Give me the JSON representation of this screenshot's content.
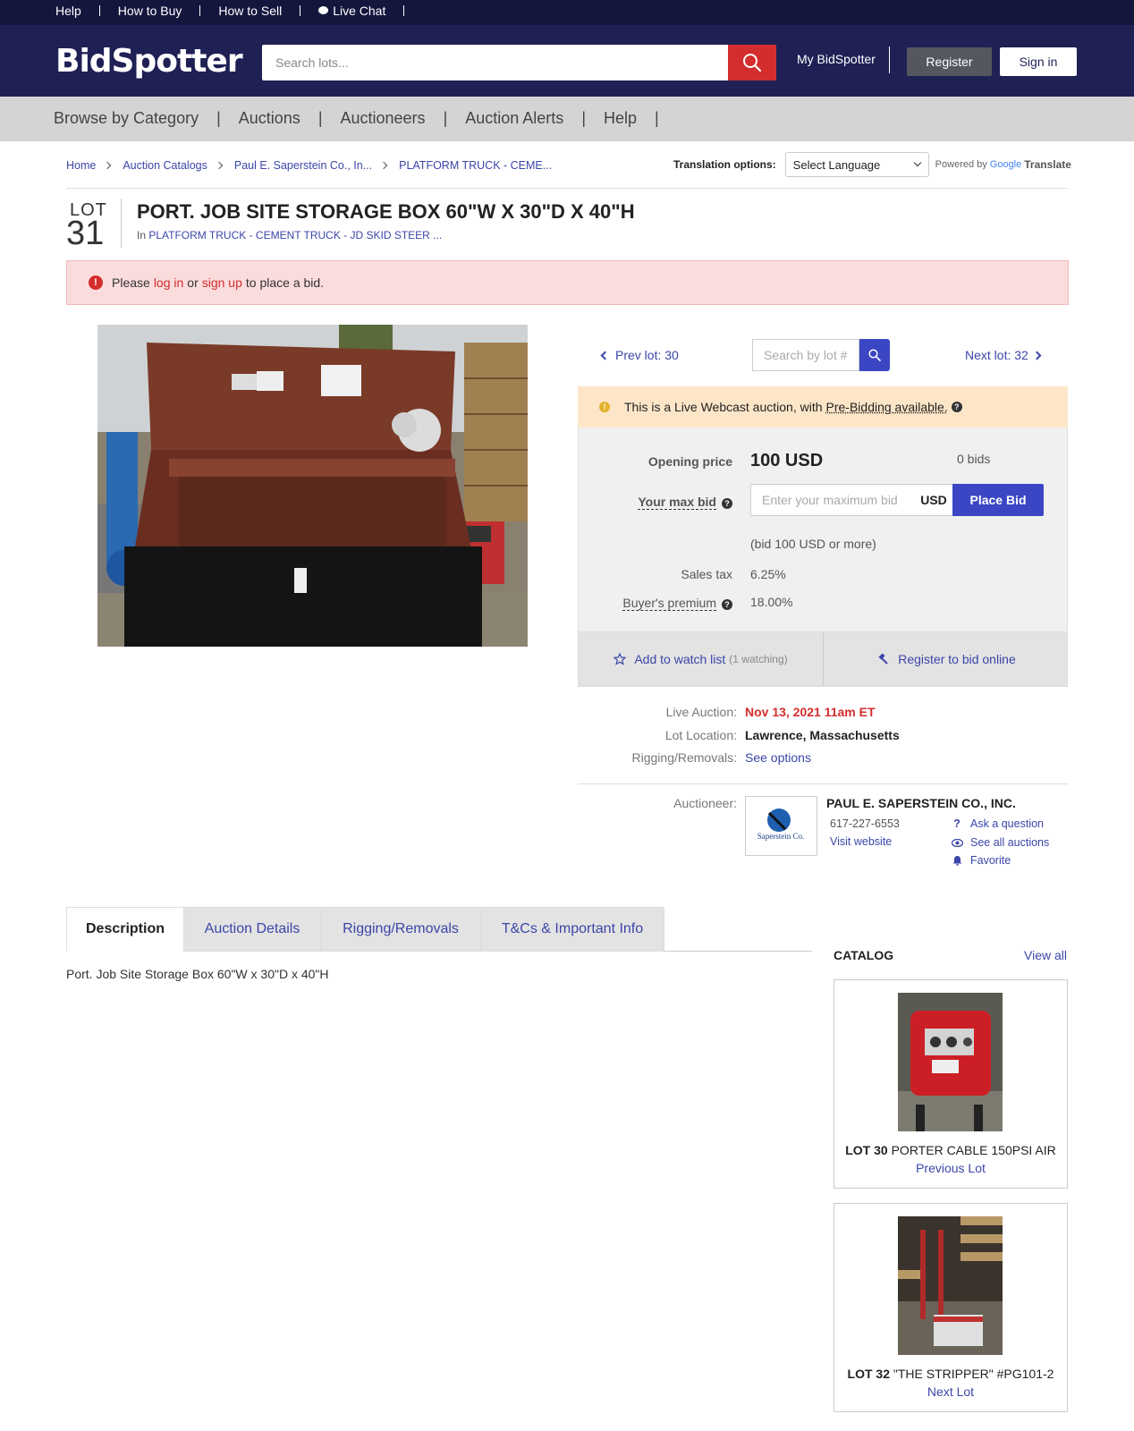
{
  "topbar": {
    "links": [
      "Help",
      "How to Buy",
      "How to Sell",
      "Live Chat"
    ]
  },
  "header": {
    "logo": "BidSpotter",
    "search_placeholder": "Search lots...",
    "my_bidspotter": "My BidSpotter",
    "register": "Register",
    "sign_in": "Sign in"
  },
  "nav": [
    "Browse by Category",
    "Auctions",
    "Auctioneers",
    "Auction Alerts",
    "Help"
  ],
  "breadcrumbs": [
    "Home",
    "Auction Catalogs",
    "Paul E. Saperstein Co., In...",
    "PLATFORM TRUCK - CEME..."
  ],
  "translation": {
    "label": "Translation options:",
    "selected": "Select Language",
    "powered": "Powered by",
    "google": "Google",
    "translate": "Translate"
  },
  "lot": {
    "word": "LOT",
    "number": "31",
    "title": "PORT. JOB SITE STORAGE BOX 60\"W X 30\"D X 40\"H",
    "in_prefix": "In",
    "in_link": "PLATFORM TRUCK - CEMENT TRUCK - JD SKID STEER ..."
  },
  "alert": {
    "please": "Please",
    "log_in": "log in",
    "or": "or",
    "sign_up": "sign up",
    "rest": "to place a bid."
  },
  "lotnav": {
    "prev": "Prev lot: 30",
    "next": "Next lot: 32",
    "search_placeholder": "Search by lot #"
  },
  "live_banner": {
    "text": "This is a Live Webcast auction, with",
    "link": "Pre-Bidding available."
  },
  "bid": {
    "opening_label": "Opening price",
    "opening_value": "100 USD",
    "bids": "0 bids",
    "max_label": "Your max bid",
    "max_placeholder": "Enter your maximum bid",
    "currency": "USD",
    "place_bid": "Place Bid",
    "hint": "(bid 100 USD or more)",
    "tax_label": "Sales tax",
    "tax_value": "6.25%",
    "premium_label": "Buyer's premium",
    "premium_value": "18.00%"
  },
  "watch": {
    "label": "Add to watch list",
    "count": "(1 watching)",
    "register": "Register to bid online"
  },
  "info": {
    "live_label": "Live Auction:",
    "live_value": "Nov 13, 2021 11am ET",
    "location_label": "Lot Location:",
    "location_value": "Lawrence, Massachusetts",
    "rigging_label": "Rigging/Removals:",
    "rigging_value": "See options",
    "auctioneer_label": "Auctioneer:"
  },
  "auctioneer": {
    "name": "PAUL E. SAPERSTEIN CO., INC.",
    "phone": "617-227-6553",
    "website": "Visit website",
    "ask": "Ask a question",
    "see_all": "See all auctions",
    "favorite": "Favorite",
    "logo_text": "Saperstein Co."
  },
  "tabs": [
    "Description",
    "Auction Details",
    "Rigging/Removals",
    "T&Cs & Important Info"
  ],
  "description": "Port. Job Site Storage Box 60\"W x 30\"D x 40\"H",
  "catalog": {
    "title": "CATALOG",
    "view_all": "View all",
    "items": [
      {
        "lot": "LOT 30",
        "title": "PORTER CABLE 150PSI AIR",
        "link": "Previous Lot"
      },
      {
        "lot": "LOT 32",
        "title": "\"THE STRIPPER\" #PG101-2",
        "link": "Next Lot"
      }
    ]
  },
  "colors": {
    "topbar": "#14163d",
    "header": "#1f2155",
    "accent_red": "#d42d2d",
    "accent_blue": "#3b46c4"
  }
}
